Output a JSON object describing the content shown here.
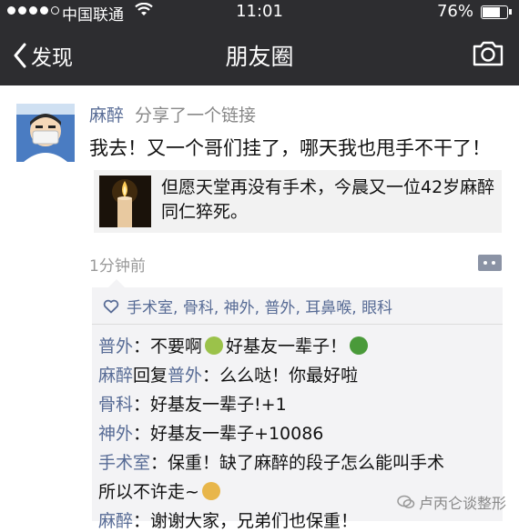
{
  "status_bar": {
    "carrier": "中国联通",
    "time": "11:01",
    "battery_percent": "76%",
    "battery_level": 0.76,
    "signal_bars_filled": 4,
    "signal_bars_total": 5
  },
  "nav": {
    "back_label": "发现",
    "title": "朋友圈"
  },
  "post": {
    "username": "麻醉",
    "action": "分享了一个链接",
    "text": "我去！又一个哥们挂了，哪天我也甩手不干了！",
    "link_title": "但愿天堂再没有手术，今晨又一位42岁麻醉同仁猝死。",
    "time_ago": "1分钟前"
  },
  "likes": [
    "手术室",
    "骨科",
    "神外",
    "普外",
    "耳鼻喉",
    "眼科"
  ],
  "comments": [
    {
      "author": "普外",
      "sep": "：",
      "text": "不要啊",
      "emoji1": "#9bc24a",
      "text2": "好基友一辈子！",
      "emoji2": "#4a9a3a"
    },
    {
      "author": "麻醉",
      "reply": "回复",
      "to": "普外",
      "sep": "：",
      "text": "么么哒！你最好啦"
    },
    {
      "author": "骨科",
      "sep": "：",
      "text": "好基友一辈子!+1"
    },
    {
      "author": "神外",
      "sep": "：",
      "text": "好基友一辈子+10086"
    },
    {
      "author": "手术室",
      "sep": "：",
      "text": "保重！缺了麻醉的段子怎么能叫手术"
    },
    {
      "text_cont": "所以不许走~",
      "emoji": "#e8b64a"
    },
    {
      "author": "麻醉",
      "sep": "：",
      "text": "谢谢大家，兄弟们也保重！"
    }
  ],
  "watermark": "卢丙仑谈整形",
  "colors": {
    "bar_bg": "#2d2d30",
    "name_blue": "#576b95"
  }
}
